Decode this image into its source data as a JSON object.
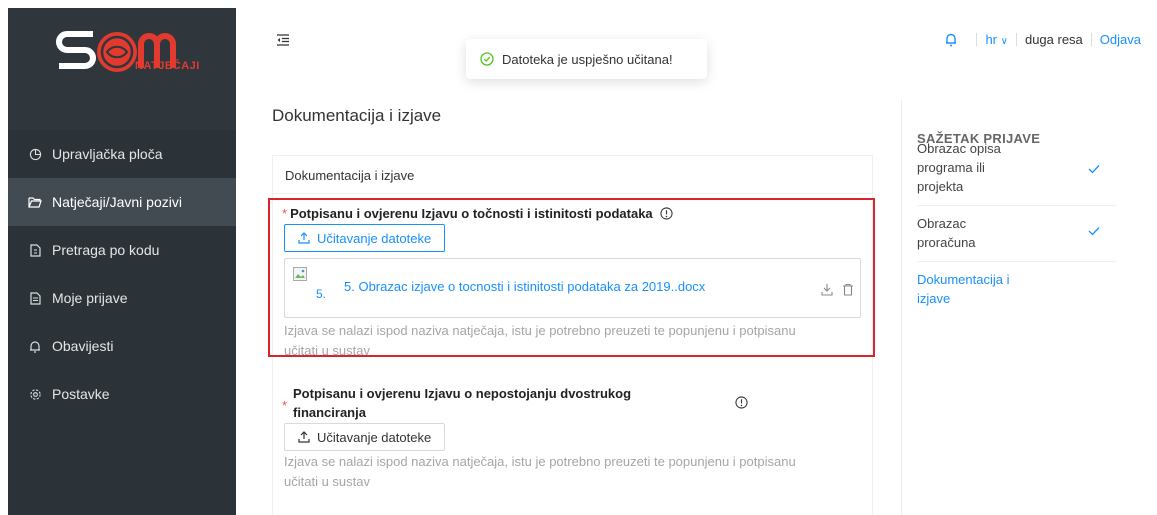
{
  "app": {
    "logo_text": "SOM",
    "logo_sub": "NATJEČAJI"
  },
  "sidebar": {
    "items": [
      {
        "label": "Upravljačka ploča",
        "icon": "dashboard-icon"
      },
      {
        "label": "Natječaji/Javni pozivi",
        "icon": "folder-open-icon",
        "active": true
      },
      {
        "label": "Pretraga po kodu",
        "icon": "file-icon"
      },
      {
        "label": "Moje prijave",
        "icon": "file-text-icon"
      },
      {
        "label": "Obavijesti",
        "icon": "bell-icon"
      },
      {
        "label": "Postavke",
        "icon": "gear-icon"
      }
    ]
  },
  "header": {
    "lang": "hr",
    "user": "duga resa",
    "logout": "Odjava"
  },
  "toast": {
    "message": "Datoteka je uspješno učitana!"
  },
  "main": {
    "title": "Dokumentacija i izjave",
    "card_title": "Dokumentacija i izjave",
    "fields": [
      {
        "label": "Potpisanu i ovjerenu Izjavu o točnosti i istinitosti podataka",
        "upload_label": "Učitavanje datoteke",
        "file_thumb_text": "5.",
        "file_name": "5. Obrazac izjave o tocnosti i istinitosti podataka za 2019..docx",
        "hint_line1": "Izjava se nalazi ispod naziva natječaja, istu je potrebno preuzeti te popunjenu i potpisanu",
        "hint_line2": "učitati u sustav"
      },
      {
        "label_line1": "Potpisanu i ovjerenu Izjavu o nepostojanju dvostrukog",
        "label_line2": "financiranja",
        "upload_label": "Učitavanje datoteke",
        "hint_line1": "Izjava se nalazi ispod naziva natječaja, istu je potrebno preuzeti te popunjenu i potpisanu",
        "hint_line2": "učitati u sustav"
      }
    ]
  },
  "summary": {
    "title": "SAŽETAK PRIJAVE",
    "items": [
      {
        "line1": "Obrazac opisa",
        "line2": "programa ili",
        "line3": "projekta",
        "done": true
      },
      {
        "line1": "Obrazac",
        "line2": "proračuna",
        "done": true
      },
      {
        "line1": "Dokumentacija i",
        "line2": "izjave",
        "current": true
      }
    ]
  },
  "colors": {
    "sidebar_bg": "#2b3238",
    "sidebar_active": "#434b52",
    "accent": "#1890ff",
    "highlight_border": "#d9232d",
    "logo_red": "#e23a2e"
  }
}
